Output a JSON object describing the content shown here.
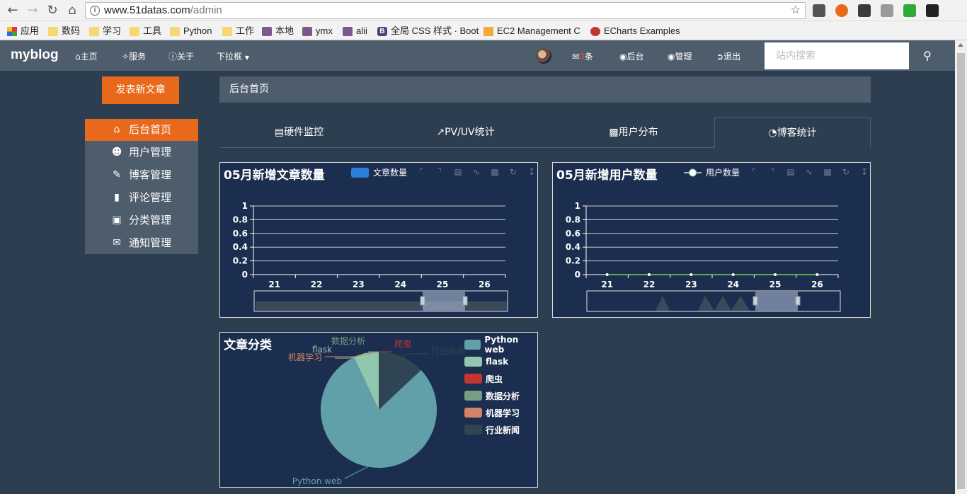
{
  "browser": {
    "url_host": "www.51datas.com",
    "url_path": "/admin",
    "bookmarks": [
      {
        "label": "应用",
        "icon": "apps-icon"
      },
      {
        "label": "数码",
        "icon": "folder-icon"
      },
      {
        "label": "学习",
        "icon": "folder-icon"
      },
      {
        "label": "工具",
        "icon": "folder-icon"
      },
      {
        "label": "Python",
        "icon": "folder-icon"
      },
      {
        "label": "工作",
        "icon": "folder-icon"
      },
      {
        "label": "本地",
        "icon": "avatar-icon"
      },
      {
        "label": "ymx",
        "icon": "avatar-icon"
      },
      {
        "label": "alii",
        "icon": "avatar-icon"
      },
      {
        "label": "全局 CSS 样式 · Boot",
        "icon": "bootstrap-icon"
      },
      {
        "label": "EC2 Management C",
        "icon": "aws-icon"
      },
      {
        "label": "ECharts Examples",
        "icon": "echarts-icon"
      }
    ]
  },
  "navbar": {
    "brand": "myblog",
    "home": "主页",
    "services": "服务",
    "about": "关于",
    "dropdown": "下拉框",
    "messages_count": "0",
    "messages_unit": "条",
    "backend": "后台",
    "manage": "管理",
    "logout": "退出",
    "search_placeholder": "站内搜索"
  },
  "sidebar": {
    "new_post": "发表新文章",
    "items": [
      {
        "label": "后台首页",
        "icon": "home-icon",
        "active": true
      },
      {
        "label": "用户管理",
        "icon": "user-icon",
        "active": false
      },
      {
        "label": "博客管理",
        "icon": "pencil-icon",
        "active": false
      },
      {
        "label": "评论管理",
        "icon": "comment-icon",
        "active": false
      },
      {
        "label": "分类管理",
        "icon": "folder-open-icon",
        "active": false
      },
      {
        "label": "通知管理",
        "icon": "envelope-icon",
        "active": false
      }
    ]
  },
  "main": {
    "breadcrumb": "后台首页",
    "tabs": [
      {
        "label": "硬件监控",
        "icon": "area-chart-icon"
      },
      {
        "label": "PV/UV统计",
        "icon": "line-chart-icon"
      },
      {
        "label": "用户分布",
        "icon": "bar-chart-icon"
      },
      {
        "label": "博客统计",
        "icon": "pie-chart-icon",
        "active": true
      }
    ]
  },
  "colors": {
    "accent": "#e8691c",
    "nav_bg": "#4e5d6c",
    "page_bg": "#2c3e50",
    "panel_bg": "#1c2e4f",
    "line_green": "#91c7ae",
    "bar_blue": "#2f7ed8"
  },
  "chart_data": [
    {
      "type": "bar",
      "title": "05月新增文章数量",
      "categories": [
        "21",
        "22",
        "23",
        "24",
        "25",
        "26"
      ],
      "series": [
        {
          "name": "文章数量",
          "values": [
            0,
            0,
            0,
            0,
            0,
            0
          ]
        }
      ],
      "ylim": [
        0,
        1
      ],
      "yticks": [
        "0",
        "0.2",
        "0.4",
        "0.6",
        "0.8",
        "1"
      ],
      "legend": "top-center",
      "grid": true
    },
    {
      "type": "line",
      "title": "05月新增用户数量",
      "categories": [
        "21",
        "22",
        "23",
        "24",
        "25",
        "26"
      ],
      "series": [
        {
          "name": "用户数量",
          "values": [
            0,
            0,
            0,
            0,
            0,
            0
          ]
        }
      ],
      "ylim": [
        0,
        1
      ],
      "yticks": [
        "0",
        "0.2",
        "0.4",
        "0.6",
        "0.8",
        "1"
      ],
      "legend": "top-center",
      "grid": true
    },
    {
      "type": "pie",
      "title": "文章分类",
      "slices": [
        {
          "name": "Python web",
          "value": 80,
          "color": "#61a0a8"
        },
        {
          "name": "flask",
          "value": 7,
          "color": "#91c7ae"
        },
        {
          "name": "爬虫",
          "value": 0,
          "color": "#c23531"
        },
        {
          "name": "数据分析",
          "value": 0,
          "color": "#749f83"
        },
        {
          "name": "机器学习",
          "value": 0,
          "color": "#d48265"
        },
        {
          "name": "行业新闻",
          "value": 13,
          "color": "#2f4554"
        }
      ],
      "legend": "right"
    }
  ]
}
